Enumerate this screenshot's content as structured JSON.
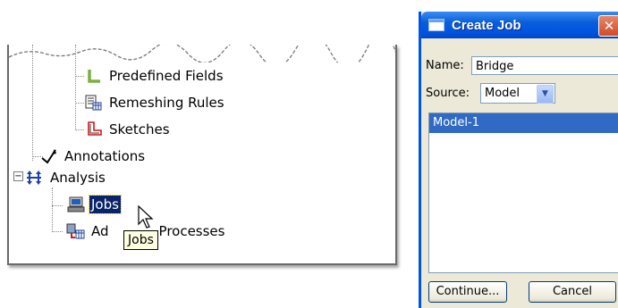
{
  "model_tree": {
    "items": [
      {
        "label": "Predefined Fields",
        "icon": "predefined-fields-icon"
      },
      {
        "label": "Remeshing Rules",
        "icon": "remeshing-rules-icon"
      },
      {
        "label": "Sketches",
        "icon": "sketches-icon"
      },
      {
        "label": "Annotations",
        "icon": "annotations-icon"
      },
      {
        "label": "Analysis",
        "icon": "analysis-icon",
        "expander": "−"
      },
      {
        "label": "Jobs",
        "icon": "jobs-icon"
      },
      {
        "label": "Ad",
        "suffix": "Processes",
        "icon": "adaptivity-processes-icon"
      }
    ],
    "tooltip": "Jobs"
  },
  "dialog": {
    "title": "Create Job",
    "close_glyph": "✕",
    "name_label": "Name:",
    "name_value": "Bridge",
    "source_label": "Source:",
    "source_value": "Model",
    "models": [
      "Model-1"
    ],
    "continue_label": "Continue...",
    "cancel_label": "Cancel"
  },
  "colors": {
    "selection": "#0a246a",
    "list_selection": "#316ac5",
    "titlebar": "#0054e3",
    "tooltip_bg": "#ffffe1"
  }
}
